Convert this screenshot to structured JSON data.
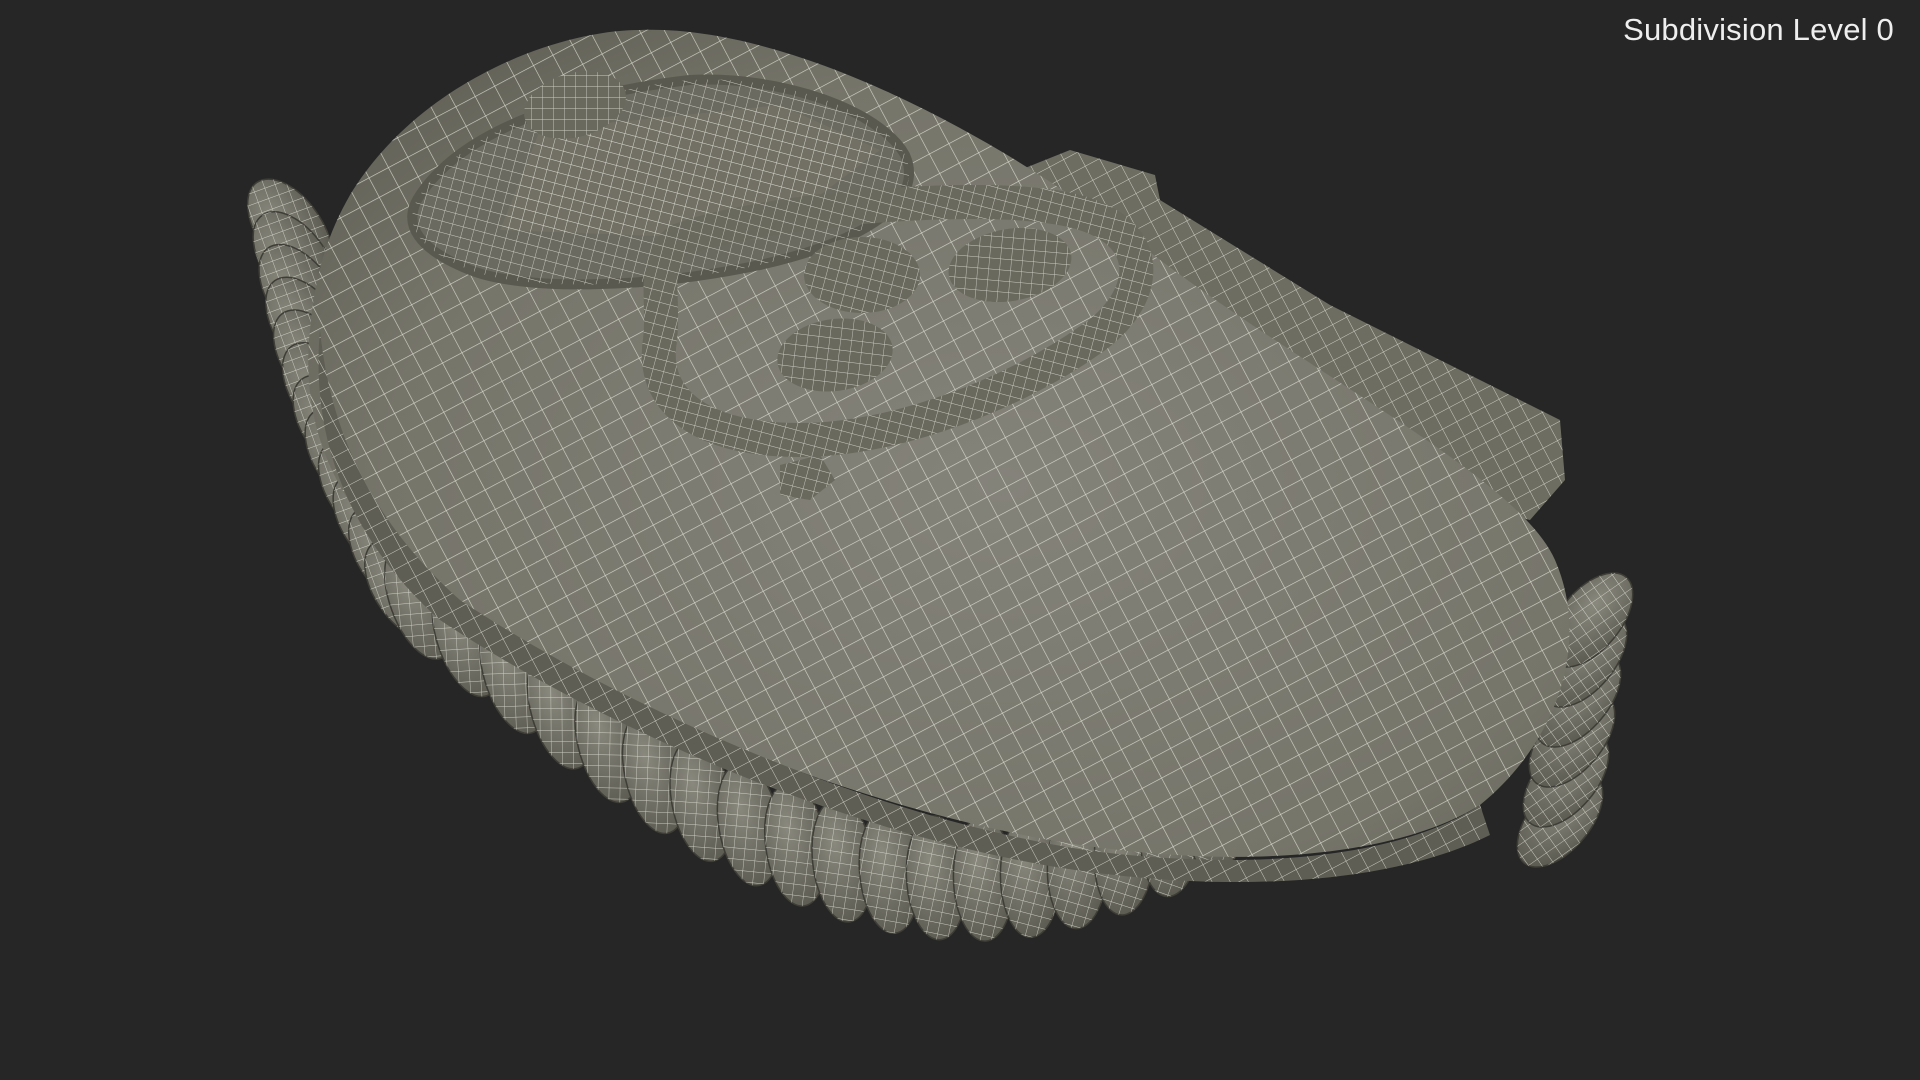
{
  "viewport": {
    "label": "Subdivision Level 0",
    "background_color": "#262626",
    "label_color": "#eeeeee"
  },
  "model": {
    "fill_color": "#7d7c6e",
    "wire_color": "#e6e6dc",
    "shadow_color": "#5e5d52"
  }
}
